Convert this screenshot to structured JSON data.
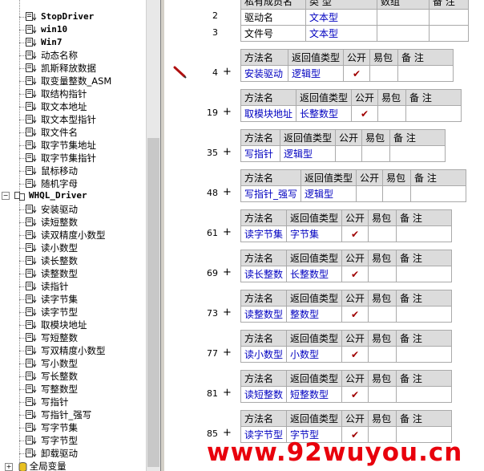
{
  "tree": {
    "items_top": [
      "StopDriver",
      "win10",
      "Win7",
      "动态名称",
      "凯斯释放数据",
      "取变量整数_ASM",
      "取结构指针",
      "取文本地址",
      "取文本型指针",
      "取文件名",
      "取字节集地址",
      "取字节集指针",
      "鼠标移动",
      "随机字母"
    ],
    "module_name": "WHQL_Driver",
    "items_module": [
      "安装驱动",
      "读短整数",
      "读双精度小数型",
      "读小数型",
      "读长整数",
      "读整数型",
      "读指针",
      "读字节集",
      "读字节型",
      "取模块地址",
      "写短整数",
      "写双精度小数型",
      "写小数型",
      "写长整数",
      "写整数型",
      "写指针",
      "写指针_强写",
      "写字节集",
      "写字节型",
      "卸载驱动"
    ],
    "global_label": "全局变量"
  },
  "gutter": {
    "rows": [
      {
        "num": "2"
      },
      {
        "num": "3"
      },
      {
        "num": "4"
      },
      {
        "num": "19"
      },
      {
        "num": "35"
      },
      {
        "num": "48"
      },
      {
        "num": "61"
      },
      {
        "num": "69"
      },
      {
        "num": "73"
      },
      {
        "num": "77"
      },
      {
        "num": "81"
      },
      {
        "num": "85"
      }
    ]
  },
  "header_labels": {
    "method": "方法名",
    "return_type": "返回值类型",
    "public": "公开",
    "easy": "易包",
    "note": "备 注",
    "local_name": "私有成员名",
    "type": "类 型",
    "array": "数组"
  },
  "params": [
    {
      "name": "驱动名",
      "type": "文本型"
    },
    {
      "name": "文件号",
      "type": "文本型"
    }
  ],
  "methods": [
    {
      "name": "安装驱动",
      "type": "逻辑型",
      "check": "✔"
    },
    {
      "name": "取模块地址",
      "type": "长整数型",
      "check": "✔"
    },
    {
      "name": "写指针",
      "type": "逻辑型",
      "check": ""
    },
    {
      "name": "写指针_强写",
      "type": "逻辑型",
      "check": ""
    },
    {
      "name": "读字节集",
      "type": "字节集",
      "check": "✔"
    },
    {
      "name": "读长整数",
      "type": "长整数型",
      "check": "✔"
    },
    {
      "name": "读整数型",
      "type": "整数型",
      "check": "✔"
    },
    {
      "name": "读小数型",
      "type": "小数型",
      "check": "✔"
    },
    {
      "name": "读短整数",
      "type": "短整数型",
      "check": "✔"
    },
    {
      "name": "读字节型",
      "type": "字节型",
      "check": "✔"
    }
  ],
  "watermark": "www.92wuyou.cn"
}
